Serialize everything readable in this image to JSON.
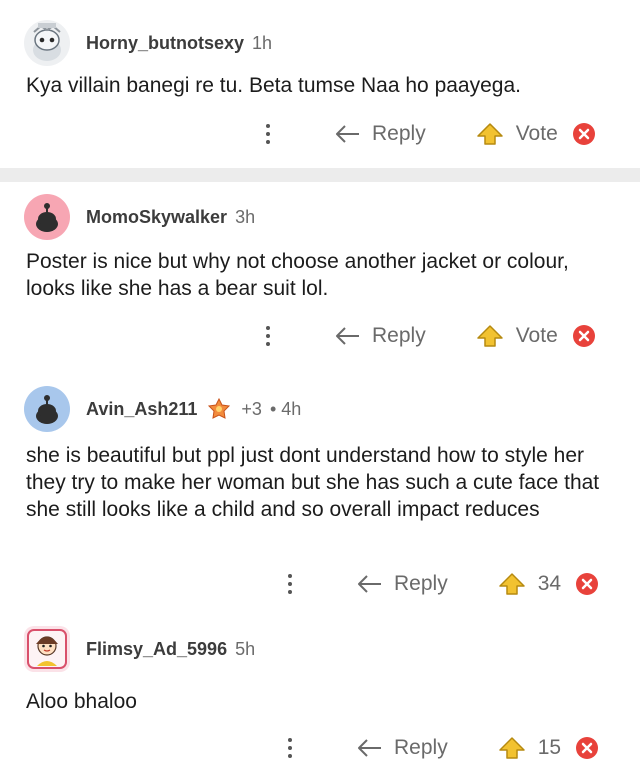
{
  "comments": [
    {
      "username": "Horny_butnotsexy",
      "time": "1h",
      "text": "Kya villain banegi re tu. Beta tumse Naa ho paayega.",
      "reply_label": "Reply",
      "vote_label": "Vote",
      "avatar_icon": "snoo-avatar-icon"
    },
    {
      "username": "MomoSkywalker",
      "time": "3h",
      "text": "Poster is nice but why not choose another jacket or colour, looks like she has a bear suit lol.",
      "reply_label": "Reply",
      "vote_label": "Vote",
      "avatar_color": "#f7a6b3"
    },
    {
      "username": "Avin_Ash211",
      "karma": "+3",
      "time": "• 4h",
      "text": "she is beautiful but ppl just dont understand how to style her they try to make her woman but she has such a cute face that she still looks like a child and so overall impact reduces",
      "reply_label": "Reply",
      "vote_label": "34",
      "avatar_color": "#a8c7ec"
    },
    {
      "username": "Flimsy_Ad_5996",
      "time": "5h",
      "text": "Aloo bhaloo",
      "reply_label": "Reply",
      "vote_label": "15"
    }
  ],
  "colors": {
    "divider": "#ececec",
    "upvote_gold": "#f2c230",
    "downvote_red": "#e8423b"
  }
}
